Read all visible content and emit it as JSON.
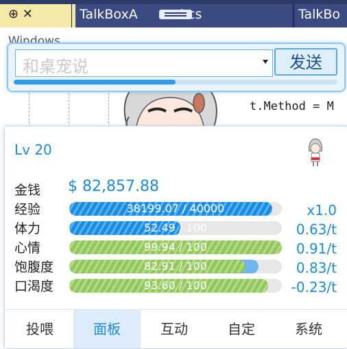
{
  "ide": {
    "pinned_tab": "⊕ ✕",
    "tabs": [
      "TalkBoxA",
      "l.cs",
      "TalkBo"
    ],
    "window_label": "Windows",
    "code_line": "t.Method = M",
    "code_line2": "t"
  },
  "chat": {
    "placeholder": "和桌宠说",
    "send_label": "发送",
    "progress": 0.5
  },
  "panel": {
    "level": "Lv 20",
    "money_label": "金钱",
    "money_value": "$ 82,857.88",
    "stats": [
      {
        "label": "经验",
        "text": "38199.07 / 40000",
        "fill": 0.955,
        "color": "blue",
        "right": "x1.0"
      },
      {
        "label": "体力",
        "text": "52.49 / 100",
        "fill": 0.525,
        "color": "blue",
        "right": "0.63/t"
      },
      {
        "label": "心情",
        "text": "99.94 / 100",
        "fill": 0.999,
        "color": "green",
        "right": "0.91/t"
      },
      {
        "label": "饱腹度",
        "text": "82.91 / 100",
        "fill": 0.83,
        "color": "green",
        "right": "0.83/t",
        "extra": 0.06
      },
      {
        "label": "口渴度",
        "text": "93.60 / 100",
        "fill": 0.936,
        "color": "green",
        "right": "-0.23/t"
      }
    ],
    "tabs": [
      {
        "label": "投喂",
        "active": false
      },
      {
        "label": "面板",
        "active": true
      },
      {
        "label": "互动",
        "active": false
      },
      {
        "label": "自定",
        "active": false
      },
      {
        "label": "系统",
        "active": false
      }
    ]
  },
  "colors": {
    "accent": "#1e8ad6",
    "ide_tab_bar": "#2b3a67",
    "green_bar": "#93c75c",
    "blue_bar": "#1a8be0"
  }
}
